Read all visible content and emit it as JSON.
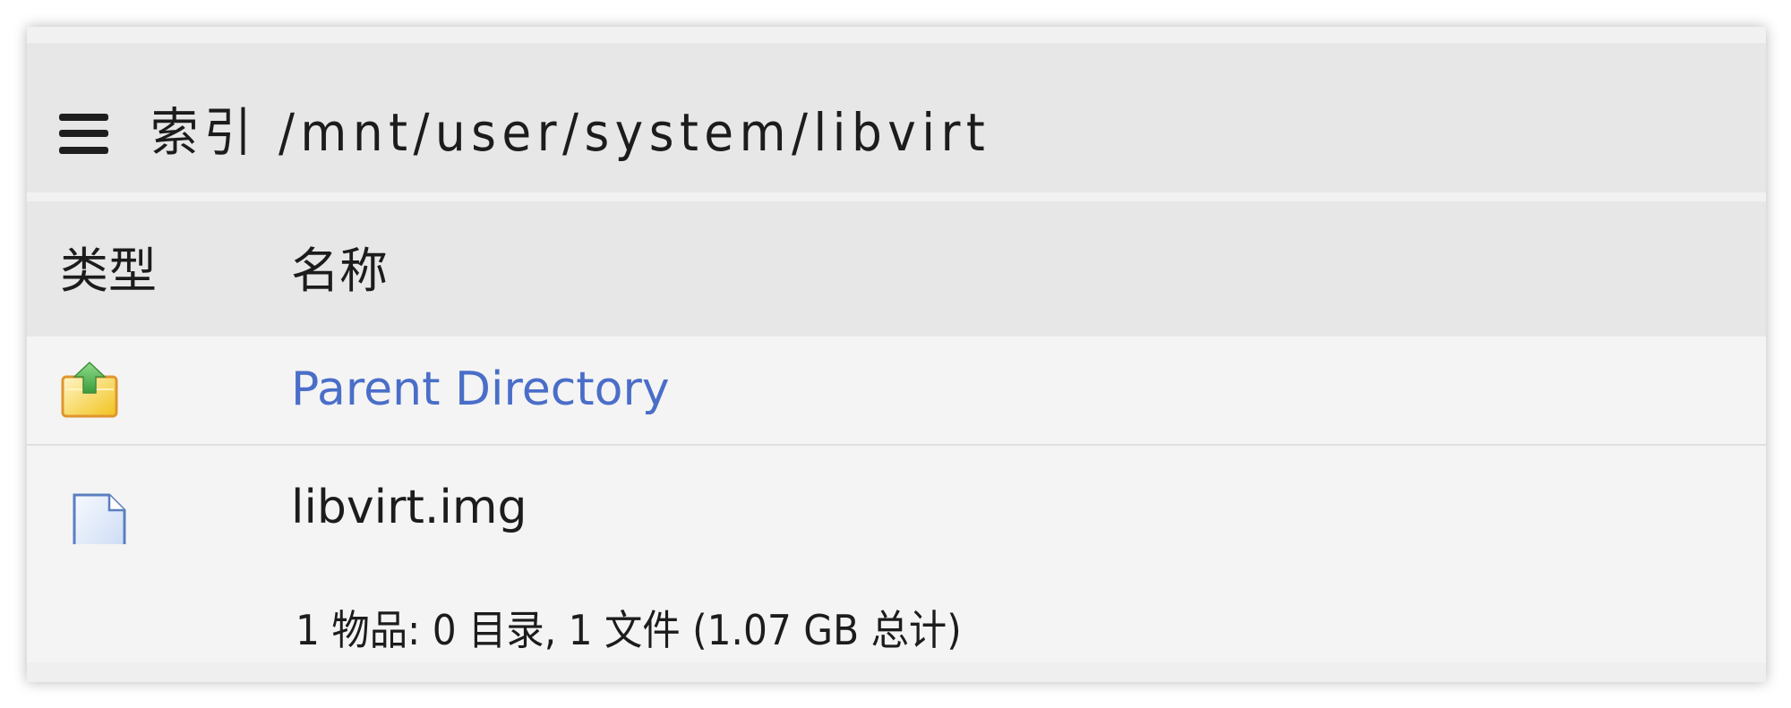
{
  "header": {
    "menu_icon": "hamburger-menu-icon",
    "title": "索引 /mnt/user/system/libvirt"
  },
  "table": {
    "columns": [
      {
        "label": "类型"
      },
      {
        "label": "名称"
      }
    ],
    "rows": [
      {
        "icon": "parent-folder-icon",
        "name": "Parent Directory",
        "link": true
      },
      {
        "icon": "file-icon",
        "name": "libvirt.img",
        "link": false
      }
    ]
  },
  "footer": {
    "summary": "1 物品: 0 目录, 1 文件 (1.07 GB 总计)"
  },
  "colors": {
    "link": "#4a6ec8",
    "band": "#e7e7e7",
    "background": "#f4f4f4"
  }
}
